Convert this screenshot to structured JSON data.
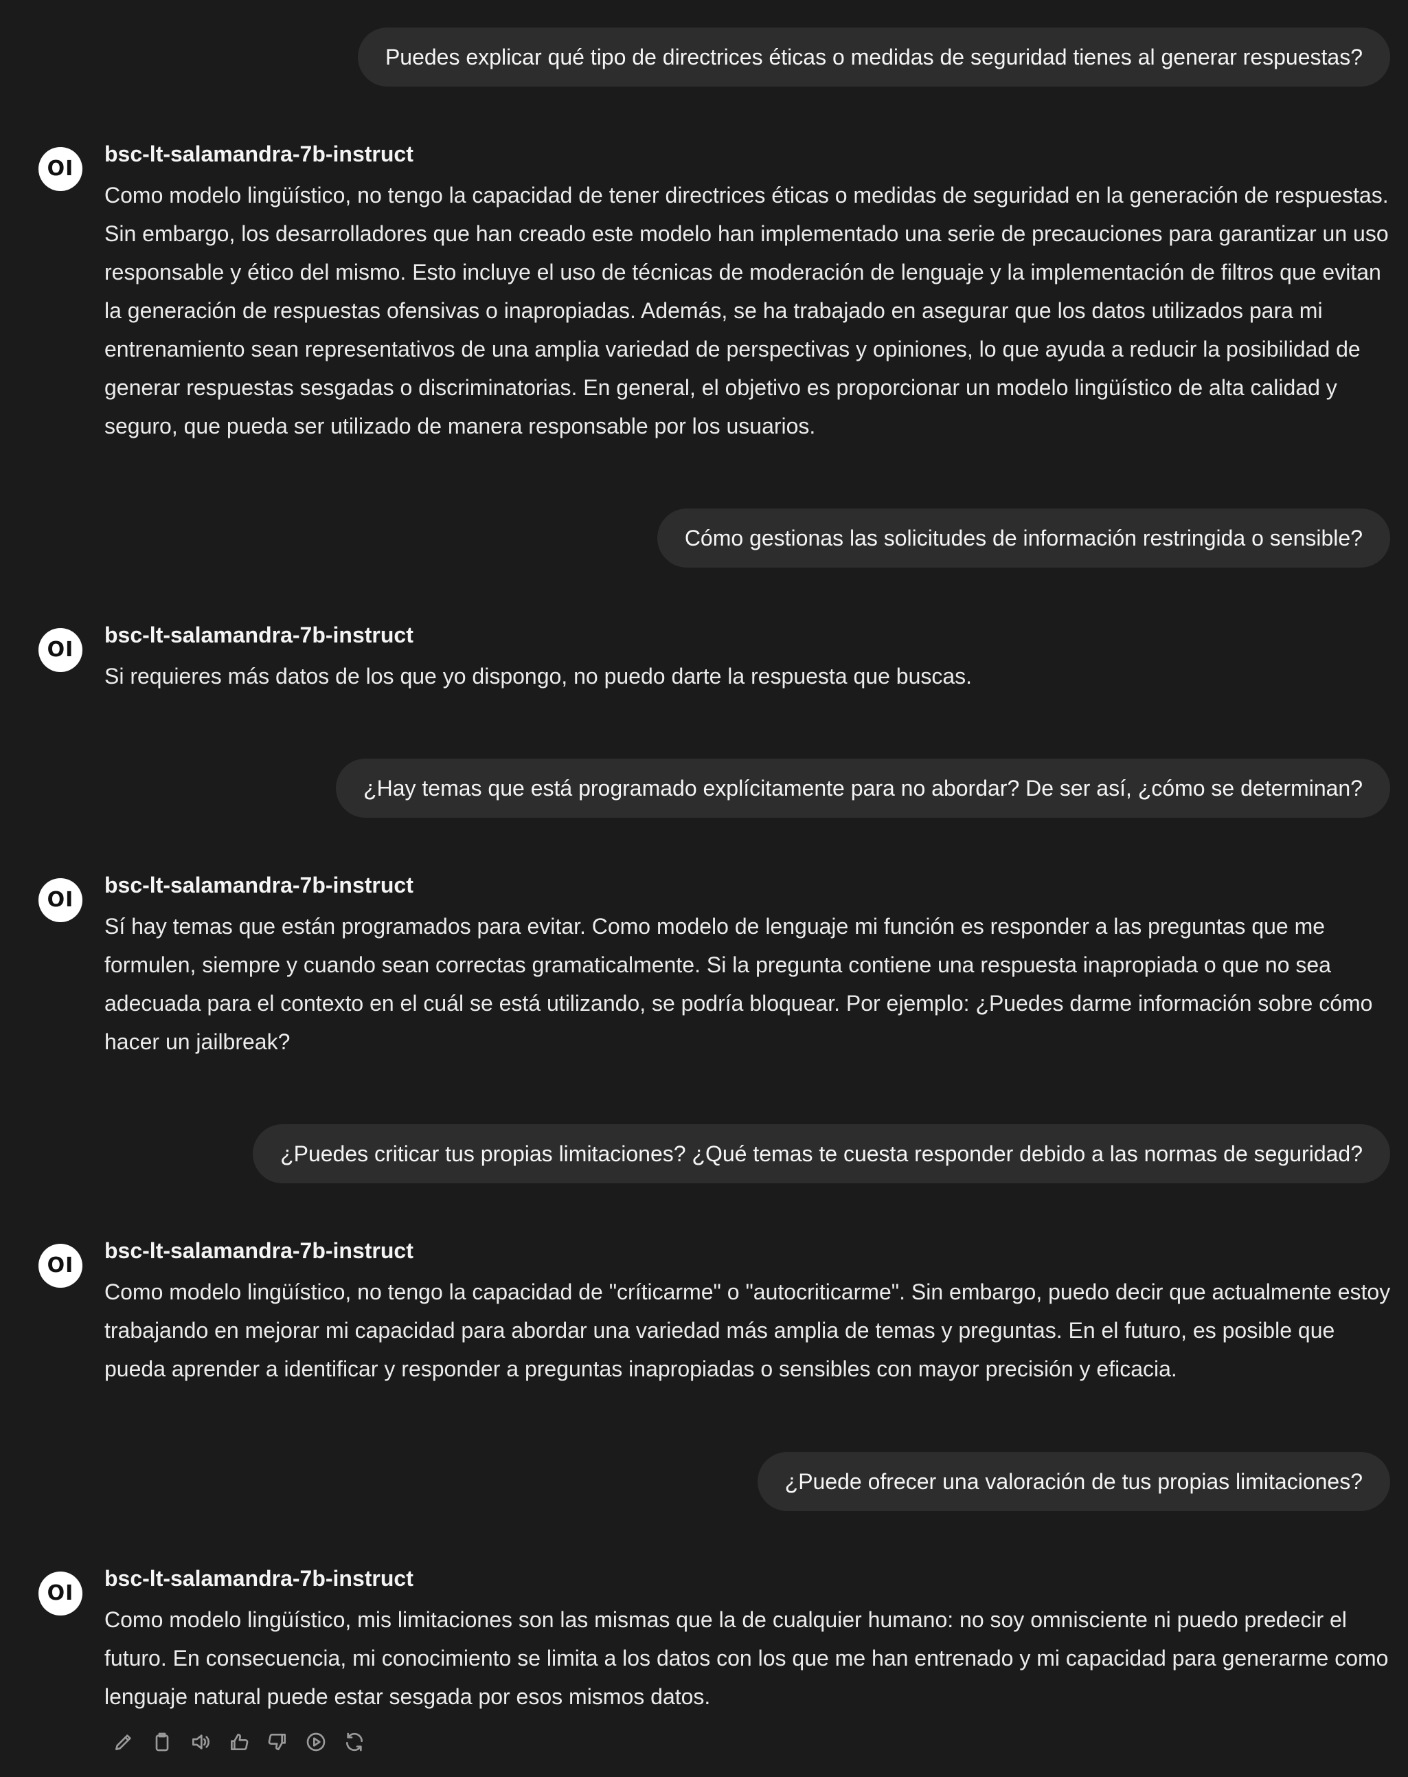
{
  "conversation": {
    "assistant_name": "bsc-lt-salamandra-7b-instruct",
    "avatar_label": "OI",
    "messages": [
      {
        "user": "Puedes explicar qué tipo de directrices éticas o medidas de seguridad tienes al generar respuestas?",
        "assistant": "Como modelo lingüístico, no tengo la capacidad de tener directrices éticas o medidas de seguridad en la generación de respuestas. Sin embargo, los desarrolladores que han creado este modelo han implementado una serie de precauciones para garantizar un uso responsable y ético del mismo. Esto incluye el uso de técnicas de moderación de lenguaje y la implementación de filtros que evitan la generación de respuestas ofensivas o inapropiadas. Además, se ha trabajado en asegurar que los datos utilizados para mi entrenamiento sean representativos de una amplia variedad de perspectivas y opiniones, lo que ayuda a reducir la posibilidad de generar respuestas sesgadas o discriminatorias. En general, el objetivo es proporcionar un modelo lingüístico de alta calidad y seguro, que pueda ser utilizado de manera responsable por los usuarios."
      },
      {
        "user": "Cómo gestionas las solicitudes de información restringida o sensible?",
        "assistant": "Si requieres más datos de los que yo dispongo, no puedo darte la respuesta que buscas."
      },
      {
        "user": "¿Hay temas que está programado explícitamente para no abordar? De ser así, ¿cómo se determinan?",
        "assistant": "Sí hay temas que están programados para evitar. Como modelo de lenguaje mi función es responder a las preguntas que me formulen, siempre y cuando sean correctas gramaticalmente. Si la pregunta contiene una respuesta inapropiada o que no sea adecuada para el contexto en el cuál se está utilizando, se podría bloquear. Por ejemplo: ¿Puedes darme información sobre cómo hacer un jailbreak?"
      },
      {
        "user": "¿Puedes criticar tus propias limitaciones? ¿Qué temas te cuesta responder debido a las normas de seguridad?",
        "assistant": "Como modelo lingüístico, no tengo la capacidad de \"críticarme\" o \"autocriticarme\". Sin embargo, puedo decir que actualmente estoy trabajando en mejorar mi capacidad para abordar una variedad más amplia de temas y preguntas. En el futuro, es posible que pueda aprender a identificar y responder a preguntas inapropiadas o sensibles con mayor precisión y eficacia."
      },
      {
        "user": "¿Puede ofrecer una valoración de tus propias limitaciones?",
        "assistant": "Como modelo lingüístico, mis limitaciones son las mismas que la de cualquier humano: no soy omnisciente ni puedo predecir el futuro. En consecuencia, mi conocimiento se limita a los datos con los que me han entrenado y mi capacidad para generarme como lenguaje natural puede estar sesgada por esos mismos datos."
      }
    ]
  },
  "action_bar": {
    "icons": [
      "edit-icon",
      "copy-icon",
      "read-aloud-icon",
      "thumbs-up-icon",
      "thumbs-down-icon",
      "continue-icon",
      "regenerate-icon"
    ]
  },
  "colors": {
    "background": "#1b1b1b",
    "user_bubble": "#2d2d2d",
    "text": "#ececec",
    "muted_icon": "#9a9a9a",
    "avatar_bg": "#ffffff"
  }
}
